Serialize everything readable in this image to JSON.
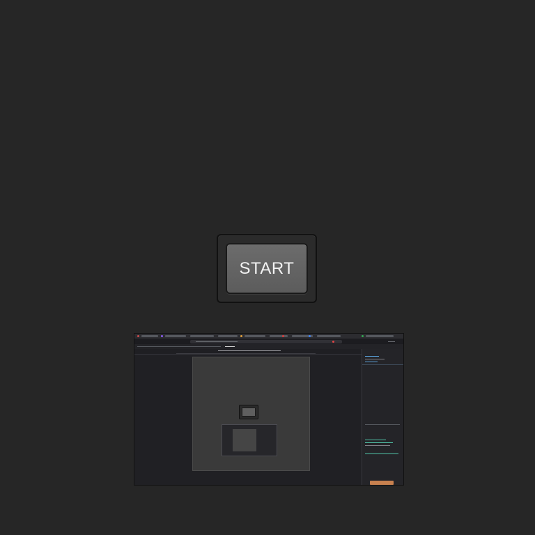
{
  "start_button": {
    "label": "START"
  },
  "thumbnail": {
    "description_visible_text": "START"
  },
  "colors": {
    "background": "#262626",
    "button_face": "#666666",
    "button_text": "#f2f2f2",
    "devtools_accent": "#c8814f"
  }
}
